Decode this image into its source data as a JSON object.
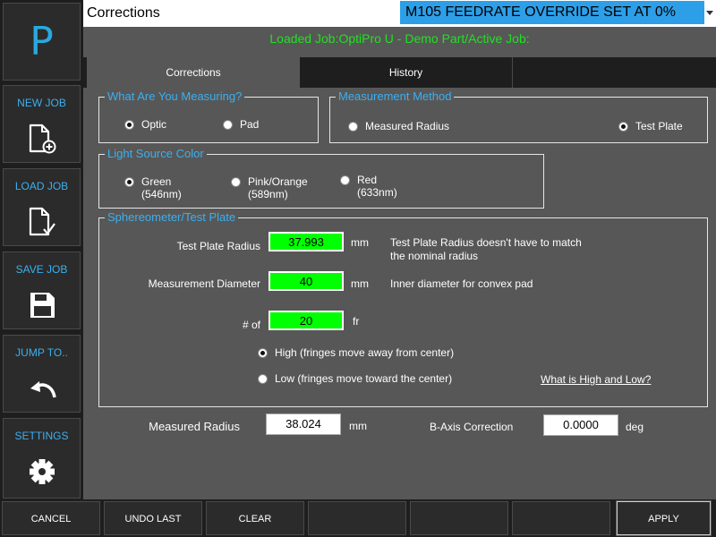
{
  "sidebar": {
    "logo": "P",
    "buttons": [
      {
        "label": "NEW JOB",
        "icon": "new-file-icon"
      },
      {
        "label": "LOAD JOB",
        "icon": "load-file-icon"
      },
      {
        "label": "SAVE JOB",
        "icon": "save-icon"
      },
      {
        "label": "JUMP TO..",
        "icon": "back-arrow-icon"
      },
      {
        "label": "SETTINGS",
        "icon": "gear-icon"
      }
    ]
  },
  "header": {
    "title": "Corrections",
    "status": "M105  FEEDRATE OVERRIDE SET AT 0%",
    "loaded_job": "Loaded Job:OptiPro U - Demo Part/Active Job:"
  },
  "tabs": [
    {
      "label": "Corrections",
      "active": true
    },
    {
      "label": "History",
      "active": false
    }
  ],
  "measuring": {
    "legend": "What Are You Measuring?",
    "options": [
      {
        "label": "Optic",
        "selected": true
      },
      {
        "label": "Pad",
        "selected": false
      }
    ]
  },
  "method": {
    "legend": "Measurement Method",
    "options": [
      {
        "label": "Measured Radius",
        "selected": false
      },
      {
        "label": "Test Plate",
        "selected": true
      }
    ]
  },
  "light": {
    "legend": "Light Source Color",
    "options": [
      {
        "line1": "Green",
        "line2": "(546nm)",
        "selected": true
      },
      {
        "line1": "Pink/Orange",
        "line2": "(589nm)",
        "selected": false
      },
      {
        "line1": "Red",
        "line2": "(633nm)",
        "selected": false
      }
    ]
  },
  "sphero": {
    "legend": "Sphereometer/Test Plate",
    "test_plate_radius": {
      "label": "Test Plate Radius",
      "value": "37.993",
      "unit": "mm",
      "note1": "Test Plate Radius doesn't have to match",
      "note2": "the nominal radius"
    },
    "meas_diameter": {
      "label": "Measurement Diameter",
      "value": "40",
      "unit": "mm",
      "note": "Inner diameter for convex pad"
    },
    "fringes": {
      "label": "# of",
      "value": "20",
      "unit": "fr"
    },
    "high": {
      "label": "High (fringes move away from center)",
      "selected": true
    },
    "low": {
      "label": "Low (fringes move toward the center)",
      "selected": false
    },
    "help_link": "What is High and Low?"
  },
  "results": {
    "measured_radius": {
      "label": "Measured Radius",
      "value": "38.024",
      "unit": "mm"
    },
    "b_axis": {
      "label": "B-Axis Correction",
      "value": "0.0000",
      "unit": "deg"
    }
  },
  "bottom": {
    "cancel": "CANCEL",
    "undo": "UNDO LAST",
    "clear": "CLEAR",
    "apply": "APPLY"
  },
  "colors": {
    "accent_blue": "#3ab0f0",
    "status_bg": "#2d9fe8",
    "input_green": "#00ff00",
    "loaded_text": "#22e022",
    "panel": "#575757"
  }
}
